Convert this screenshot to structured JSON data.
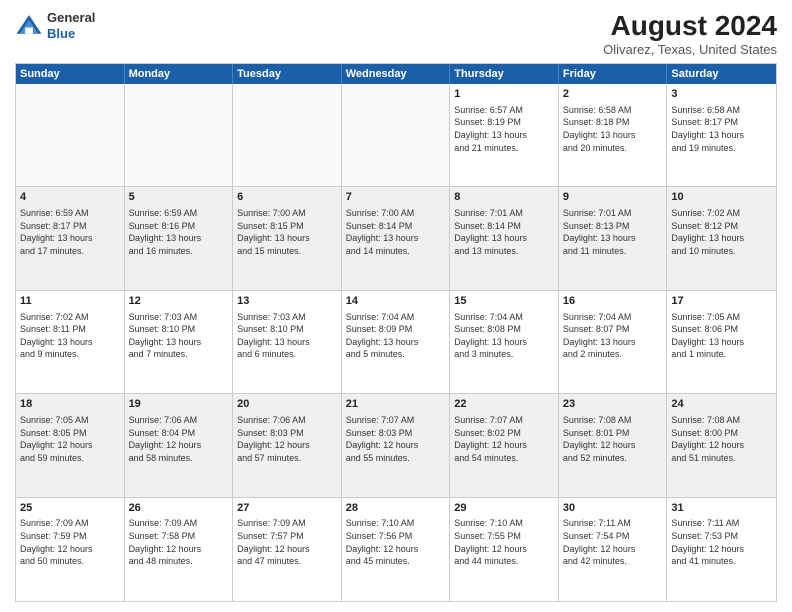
{
  "logo": {
    "general": "General",
    "blue": "Blue"
  },
  "title": {
    "month": "August 2024",
    "location": "Olivarez, Texas, United States"
  },
  "days": [
    "Sunday",
    "Monday",
    "Tuesday",
    "Wednesday",
    "Thursday",
    "Friday",
    "Saturday"
  ],
  "weeks": [
    [
      {
        "day": "",
        "text": ""
      },
      {
        "day": "",
        "text": ""
      },
      {
        "day": "",
        "text": ""
      },
      {
        "day": "",
        "text": ""
      },
      {
        "day": "1",
        "text": "Sunrise: 6:57 AM\nSunset: 8:19 PM\nDaylight: 13 hours\nand 21 minutes."
      },
      {
        "day": "2",
        "text": "Sunrise: 6:58 AM\nSunset: 8:18 PM\nDaylight: 13 hours\nand 20 minutes."
      },
      {
        "day": "3",
        "text": "Sunrise: 6:58 AM\nSunset: 8:17 PM\nDaylight: 13 hours\nand 19 minutes."
      }
    ],
    [
      {
        "day": "4",
        "text": "Sunrise: 6:59 AM\nSunset: 8:17 PM\nDaylight: 13 hours\nand 17 minutes."
      },
      {
        "day": "5",
        "text": "Sunrise: 6:59 AM\nSunset: 8:16 PM\nDaylight: 13 hours\nand 16 minutes."
      },
      {
        "day": "6",
        "text": "Sunrise: 7:00 AM\nSunset: 8:15 PM\nDaylight: 13 hours\nand 15 minutes."
      },
      {
        "day": "7",
        "text": "Sunrise: 7:00 AM\nSunset: 8:14 PM\nDaylight: 13 hours\nand 14 minutes."
      },
      {
        "day": "8",
        "text": "Sunrise: 7:01 AM\nSunset: 8:14 PM\nDaylight: 13 hours\nand 13 minutes."
      },
      {
        "day": "9",
        "text": "Sunrise: 7:01 AM\nSunset: 8:13 PM\nDaylight: 13 hours\nand 11 minutes."
      },
      {
        "day": "10",
        "text": "Sunrise: 7:02 AM\nSunset: 8:12 PM\nDaylight: 13 hours\nand 10 minutes."
      }
    ],
    [
      {
        "day": "11",
        "text": "Sunrise: 7:02 AM\nSunset: 8:11 PM\nDaylight: 13 hours\nand 9 minutes."
      },
      {
        "day": "12",
        "text": "Sunrise: 7:03 AM\nSunset: 8:10 PM\nDaylight: 13 hours\nand 7 minutes."
      },
      {
        "day": "13",
        "text": "Sunrise: 7:03 AM\nSunset: 8:10 PM\nDaylight: 13 hours\nand 6 minutes."
      },
      {
        "day": "14",
        "text": "Sunrise: 7:04 AM\nSunset: 8:09 PM\nDaylight: 13 hours\nand 5 minutes."
      },
      {
        "day": "15",
        "text": "Sunrise: 7:04 AM\nSunset: 8:08 PM\nDaylight: 13 hours\nand 3 minutes."
      },
      {
        "day": "16",
        "text": "Sunrise: 7:04 AM\nSunset: 8:07 PM\nDaylight: 13 hours\nand 2 minutes."
      },
      {
        "day": "17",
        "text": "Sunrise: 7:05 AM\nSunset: 8:06 PM\nDaylight: 13 hours\nand 1 minute."
      }
    ],
    [
      {
        "day": "18",
        "text": "Sunrise: 7:05 AM\nSunset: 8:05 PM\nDaylight: 12 hours\nand 59 minutes."
      },
      {
        "day": "19",
        "text": "Sunrise: 7:06 AM\nSunset: 8:04 PM\nDaylight: 12 hours\nand 58 minutes."
      },
      {
        "day": "20",
        "text": "Sunrise: 7:06 AM\nSunset: 8:03 PM\nDaylight: 12 hours\nand 57 minutes."
      },
      {
        "day": "21",
        "text": "Sunrise: 7:07 AM\nSunset: 8:03 PM\nDaylight: 12 hours\nand 55 minutes."
      },
      {
        "day": "22",
        "text": "Sunrise: 7:07 AM\nSunset: 8:02 PM\nDaylight: 12 hours\nand 54 minutes."
      },
      {
        "day": "23",
        "text": "Sunrise: 7:08 AM\nSunset: 8:01 PM\nDaylight: 12 hours\nand 52 minutes."
      },
      {
        "day": "24",
        "text": "Sunrise: 7:08 AM\nSunset: 8:00 PM\nDaylight: 12 hours\nand 51 minutes."
      }
    ],
    [
      {
        "day": "25",
        "text": "Sunrise: 7:09 AM\nSunset: 7:59 PM\nDaylight: 12 hours\nand 50 minutes."
      },
      {
        "day": "26",
        "text": "Sunrise: 7:09 AM\nSunset: 7:58 PM\nDaylight: 12 hours\nand 48 minutes."
      },
      {
        "day": "27",
        "text": "Sunrise: 7:09 AM\nSunset: 7:57 PM\nDaylight: 12 hours\nand 47 minutes."
      },
      {
        "day": "28",
        "text": "Sunrise: 7:10 AM\nSunset: 7:56 PM\nDaylight: 12 hours\nand 45 minutes."
      },
      {
        "day": "29",
        "text": "Sunrise: 7:10 AM\nSunset: 7:55 PM\nDaylight: 12 hours\nand 44 minutes."
      },
      {
        "day": "30",
        "text": "Sunrise: 7:11 AM\nSunset: 7:54 PM\nDaylight: 12 hours\nand 42 minutes."
      },
      {
        "day": "31",
        "text": "Sunrise: 7:11 AM\nSunset: 7:53 PM\nDaylight: 12 hours\nand 41 minutes."
      }
    ]
  ]
}
